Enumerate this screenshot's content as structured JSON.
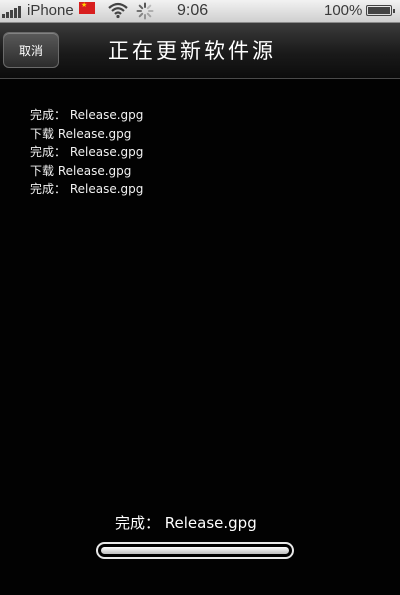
{
  "status_bar": {
    "carrier": "iPhone",
    "time": "9:06",
    "battery": "100%"
  },
  "nav": {
    "cancel_label": "取消",
    "title": "正在更新软件源"
  },
  "log_lines": [
    "完成： Release.gpg",
    "下载 Release.gpg",
    "完成： Release.gpg",
    "下载 Release.gpg",
    "完成： Release.gpg"
  ],
  "current_status": "完成： Release.gpg",
  "progress": 1.0,
  "icons": [
    "signal-icon",
    "flag-icon",
    "wifi-icon",
    "activity-spinner-icon",
    "battery-icon"
  ]
}
